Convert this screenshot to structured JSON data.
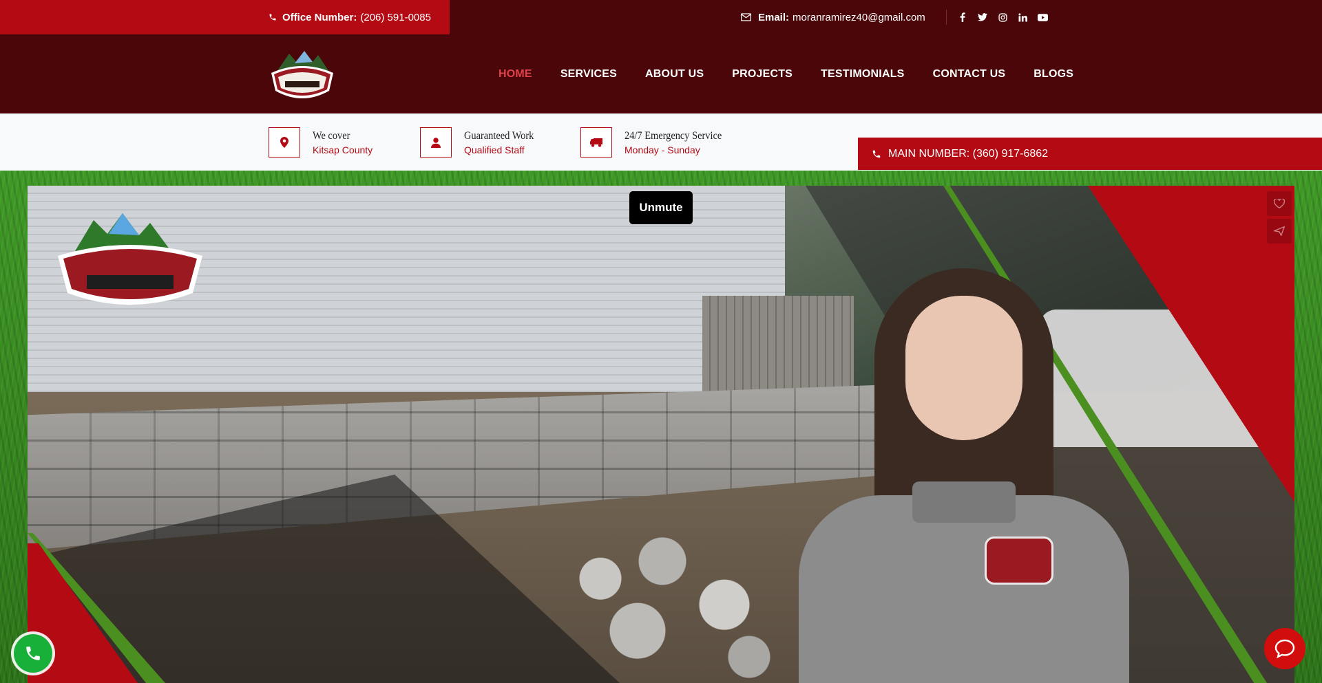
{
  "topbar": {
    "office_label": "Office Number:",
    "office_phone": "(206) 591-0085",
    "email_label": "Email:",
    "email_value": "moranramirez40@gmail.com",
    "socials": [
      "facebook-icon",
      "twitter-icon",
      "instagram-icon",
      "linkedin-icon",
      "youtube-icon"
    ]
  },
  "nav": {
    "items": [
      {
        "label": "HOME",
        "active": true
      },
      {
        "label": "SERVICES"
      },
      {
        "label": "ABOUT US"
      },
      {
        "label": "PROJECTS"
      },
      {
        "label": "TESTIMONIALS"
      },
      {
        "label": "CONTACT US"
      },
      {
        "label": "BLOGS"
      }
    ]
  },
  "info": [
    {
      "icon": "map-pin-icon",
      "title": "We cover",
      "sub": "Kitsap County"
    },
    {
      "icon": "user-icon",
      "title": "Guaranteed Work",
      "sub": "Qualified Staff"
    },
    {
      "icon": "truck-icon",
      "title": "24/7 Emergency Service",
      "sub": "Monday - Sunday"
    }
  ],
  "main_number": "MAIN NUMBER: (360) 917-6862",
  "hero": {
    "unmute_label": "Unmute"
  },
  "colors": {
    "brand_red": "#b30a14",
    "dark_maroon": "#4a0608",
    "nav_active": "#e0424a",
    "call_green": "#19b03a"
  }
}
